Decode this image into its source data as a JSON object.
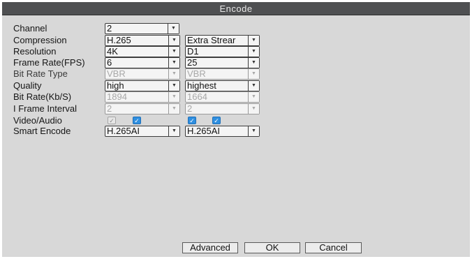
{
  "window": {
    "title": "Encode"
  },
  "rows": [
    {
      "label": "Channel",
      "col1": "2"
    },
    {
      "label": "Compression",
      "col1": "H.265",
      "col2": "Extra Strear"
    },
    {
      "label": "Resolution",
      "col1": "4K",
      "col2": "D1"
    },
    {
      "label": "Frame Rate(FPS)",
      "col1": "6",
      "col2": "25"
    },
    {
      "label": "Bit Rate Type",
      "col1": "VBR",
      "col2": "VBR"
    },
    {
      "label": "Quality",
      "col1": "high",
      "col2": "highest"
    },
    {
      "label": "Bit Rate(Kb/S)",
      "col1": "1894",
      "col2": "1664"
    },
    {
      "label": "I Frame Interval",
      "col1": "2",
      "col2": "2"
    },
    {
      "label": "Video/Audio"
    },
    {
      "label": "Smart Encode",
      "col1": "H.265AI",
      "col2": "H.265AI"
    }
  ],
  "buttons": {
    "advanced": "Advanced",
    "ok": "OK",
    "cancel": "Cancel"
  },
  "colors": {
    "titlebar": "#4f5052",
    "panel": "#d8d8d8",
    "checkbox_on": "#2f8fe0"
  },
  "icons": {
    "dropdown": "chevron-down-icon",
    "check": "check-icon"
  }
}
